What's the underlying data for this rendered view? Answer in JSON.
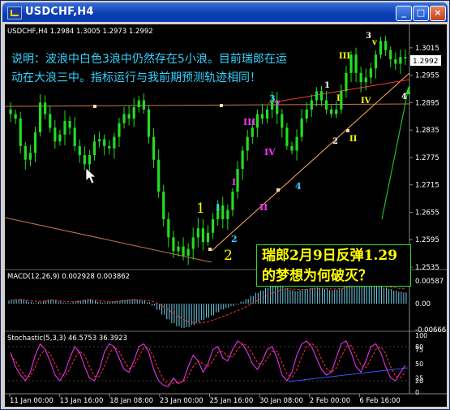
{
  "window": {
    "title": "USDCHF,H4",
    "buttons": {
      "minimize": "_",
      "maximize": "□",
      "close": "×"
    }
  },
  "price_panel": {
    "header": "USDCHF,H4  1.2984 1.3005 1.2973 1.2992",
    "current_price": "1.2992",
    "comment_line1": "说明：波浪中白色3浪中仍然存在5小浪。目前瑞郎在运",
    "comment_line2": "动在大浪三中。指标运行与我前期预测轨迹相同！",
    "callout_line1": "瑞郎2月9日反弹1.29",
    "callout_line2": "的梦想为何破灭？"
  },
  "macd_panel": {
    "header": "MACD(12,26,9)  0.002928  0.003862"
  },
  "stoch_panel": {
    "header": "Stochastic(5,3,3)  46.5753  36.3923"
  },
  "colors": {
    "background": "#000000",
    "candles": "#22dd22",
    "axis_text": "#ffffff",
    "comment_text": "#33d2ff",
    "callout_text": "#ffff00",
    "wave_yellow": "#ffff00",
    "wave_magenta": "#ff33ff",
    "wave_cyan": "#33d2ff",
    "wave_white": "#ffffff",
    "trendline_brown": "#c87848",
    "trendline_red": "#ff3333",
    "support_orange": "#ffb060",
    "green_arrow": "#22dd22",
    "macd_hist": "#6fd0e8",
    "macd_signal": "#ff3333",
    "stoch_main": "#ff33ff",
    "stoch_signal": "#ff3333",
    "stoch_trend": "#3355ff"
  },
  "chart_data": [
    {
      "type": "candlestick",
      "symbol": "USDCHF",
      "timeframe": "H4",
      "ohlc_current": {
        "open": 1.2984,
        "high": 1.3005,
        "low": 1.2973,
        "close": 1.2992
      },
      "x_tick_labels": [
        "11 Jan 00:00",
        "13 Jan 16:00",
        "18 Jan 08:00",
        "23 Jan 00:00",
        "25 Jan 16:00",
        "30 Jan 08:00",
        "2 Feb 00:00",
        "6 Feb 16:00"
      ],
      "y_tick_labels": [
        "1.3015",
        "1.2955",
        "1.2895",
        "1.2835",
        "1.2775",
        "1.2715",
        "1.2655",
        "1.2595",
        "1.2535"
      ],
      "ylim": [
        1.2535,
        1.3045
      ],
      "close_path": [
        1.287,
        1.286,
        1.28,
        1.277,
        1.2785,
        1.283,
        1.2895,
        1.287,
        1.284,
        1.281,
        1.2825,
        1.2855,
        1.284,
        1.28,
        1.278,
        1.276,
        1.278,
        1.281,
        1.2815,
        1.28,
        1.2795,
        1.282,
        1.285,
        1.287,
        1.286,
        1.2885,
        1.29,
        1.288,
        1.282,
        1.277,
        1.27,
        1.264,
        1.26,
        1.257,
        1.258,
        1.256,
        1.2575,
        1.26,
        1.262,
        1.259,
        1.261,
        1.264,
        1.267,
        1.264,
        1.266,
        1.27,
        1.275,
        1.279,
        1.282,
        1.284,
        1.287,
        1.286,
        1.288,
        1.29,
        1.287,
        1.284,
        1.28,
        1.279,
        1.282,
        1.286,
        1.288,
        1.29,
        1.292,
        1.29,
        1.288,
        1.287,
        1.288,
        1.292,
        1.296,
        1.3,
        1.296,
        1.294,
        1.295,
        1.297,
        1.3,
        1.303,
        1.301,
        1.299,
        1.298,
        1.2995,
        1.2992
      ],
      "wave_labels": [
        {
          "text": "1",
          "color": "yellow"
        },
        {
          "text": "2",
          "color": "yellow"
        },
        {
          "text": "1",
          "color": "cyan"
        },
        {
          "text": "2",
          "color": "cyan"
        },
        {
          "text": "3",
          "color": "cyan"
        },
        {
          "text": "4",
          "color": "cyan"
        },
        {
          "text": "I",
          "color": "magenta"
        },
        {
          "text": "II",
          "color": "magenta"
        },
        {
          "text": "III",
          "color": "magenta"
        },
        {
          "text": "IV",
          "color": "magenta"
        },
        {
          "text": "v",
          "color": "magenta"
        },
        {
          "text": "1",
          "color": "white"
        },
        {
          "text": "2",
          "color": "white"
        },
        {
          "text": "3",
          "color": "white"
        },
        {
          "text": "4",
          "color": "white"
        },
        {
          "text": "I",
          "color": "yellow"
        },
        {
          "text": "II",
          "color": "yellow"
        },
        {
          "text": "III",
          "color": "yellow"
        },
        {
          "text": "IV",
          "color": "yellow"
        },
        {
          "text": "v",
          "color": "yellow"
        }
      ]
    },
    {
      "type": "bar",
      "name": "MACD(12,26,9)",
      "main": 0.002928,
      "signal": 0.003862,
      "y_tick_labels": [
        "0.00587",
        "0.00",
        "-0.00666"
      ],
      "ylim": [
        -0.00666,
        0.00587
      ],
      "histogram": [
        0.0008,
        0.001,
        0.0012,
        0.0009,
        0.0005,
        0.0002,
        0.0004,
        0.0008,
        0.0011,
        0.001,
        0.0006,
        0.0003,
        0.0002,
        0.0005,
        0.0008,
        0.001,
        0.0012,
        0.0009,
        0.0005,
        0.0003,
        0.0004,
        0.0006,
        0.0008,
        0.001,
        0.0011,
        0.0012,
        0.001,
        0.0008,
        0.0004,
        -0.0005,
        -0.0015,
        -0.0028,
        -0.004,
        -0.005,
        -0.0058,
        -0.0062,
        -0.006,
        -0.0055,
        -0.0048,
        -0.0042,
        -0.0036,
        -0.003,
        -0.0022,
        -0.0015,
        -0.001,
        -0.0006,
        -0.0002,
        0.0005,
        0.0012,
        0.002,
        0.0028,
        0.0034,
        0.004,
        0.0045,
        0.0048,
        0.0045,
        0.004,
        0.0035,
        0.0033,
        0.0035,
        0.0038,
        0.004,
        0.0042,
        0.004,
        0.0038,
        0.0035,
        0.0036,
        0.004,
        0.0045,
        0.005,
        0.0052,
        0.005,
        0.0047,
        0.0045,
        0.0044,
        0.0045,
        0.0042,
        0.0038,
        0.0034,
        0.0031,
        0.0029
      ],
      "signal_line": [
        0.0009,
        0.001,
        0.0011,
        0.001,
        0.0008,
        0.0006,
        0.0006,
        0.0007,
        0.0009,
        0.0009,
        0.0008,
        0.0006,
        0.0005,
        0.0005,
        0.0006,
        0.0008,
        0.0009,
        0.0009,
        0.0008,
        0.0006,
        0.0005,
        0.0005,
        0.0006,
        0.0008,
        0.0009,
        0.001,
        0.001,
        0.0009,
        0.0008,
        0.0005,
        0.0,
        -0.0008,
        -0.0016,
        -0.0025,
        -0.0033,
        -0.004,
        -0.0046,
        -0.0049,
        -0.005,
        -0.0049,
        -0.0046,
        -0.0042,
        -0.0038,
        -0.0033,
        -0.0028,
        -0.0023,
        -0.0018,
        -0.0012,
        -0.0006,
        0.0001,
        0.0008,
        0.0015,
        0.0021,
        0.0027,
        0.0032,
        0.0036,
        0.0038,
        0.0038,
        0.0037,
        0.0037,
        0.0037,
        0.0038,
        0.0039,
        0.004,
        0.0039,
        0.0038,
        0.0038,
        0.0039,
        0.0041,
        0.0044,
        0.0046,
        0.0048,
        0.0048,
        0.0047,
        0.0046,
        0.0046,
        0.0045,
        0.0043,
        0.0041,
        0.0039,
        0.0039
      ]
    },
    {
      "type": "line",
      "name": "Stochastic(5,3,3)",
      "main": 46.5753,
      "signal": 36.3923,
      "y_tick_labels": [
        "100",
        "80",
        "75",
        "50",
        "25",
        "20",
        "0"
      ],
      "ylim": [
        0,
        100
      ],
      "series": [
        {
          "name": "main",
          "values": [
            70,
            45,
            30,
            20,
            35,
            65,
            85,
            75,
            55,
            30,
            20,
            35,
            60,
            80,
            70,
            45,
            25,
            20,
            40,
            70,
            85,
            80,
            60,
            40,
            35,
            55,
            80,
            85,
            70,
            40,
            20,
            12,
            10,
            25,
            15,
            20,
            45,
            65,
            55,
            35,
            50,
            75,
            80,
            60,
            55,
            75,
            90,
            85,
            70,
            50,
            40,
            55,
            75,
            80,
            60,
            30,
            20,
            35,
            65,
            85,
            90,
            80,
            60,
            40,
            30,
            35,
            60,
            85,
            90,
            70,
            45,
            35,
            55,
            80,
            85,
            70,
            45,
            25,
            20,
            35,
            47
          ]
        },
        {
          "name": "signal",
          "values": [
            65,
            55,
            40,
            28,
            28,
            45,
            65,
            75,
            68,
            50,
            32,
            28,
            40,
            60,
            72,
            65,
            45,
            28,
            28,
            45,
            68,
            80,
            72,
            55,
            42,
            45,
            62,
            78,
            78,
            62,
            40,
            22,
            14,
            16,
            17,
            18,
            28,
            45,
            55,
            50,
            45,
            55,
            70,
            72,
            63,
            62,
            75,
            85,
            82,
            68,
            52,
            48,
            58,
            72,
            72,
            52,
            32,
            26,
            40,
            62,
            80,
            86,
            78,
            58,
            42,
            35,
            42,
            62,
            80,
            82,
            65,
            48,
            43,
            58,
            75,
            80,
            68,
            45,
            28,
            25,
            36
          ]
        }
      ]
    }
  ]
}
